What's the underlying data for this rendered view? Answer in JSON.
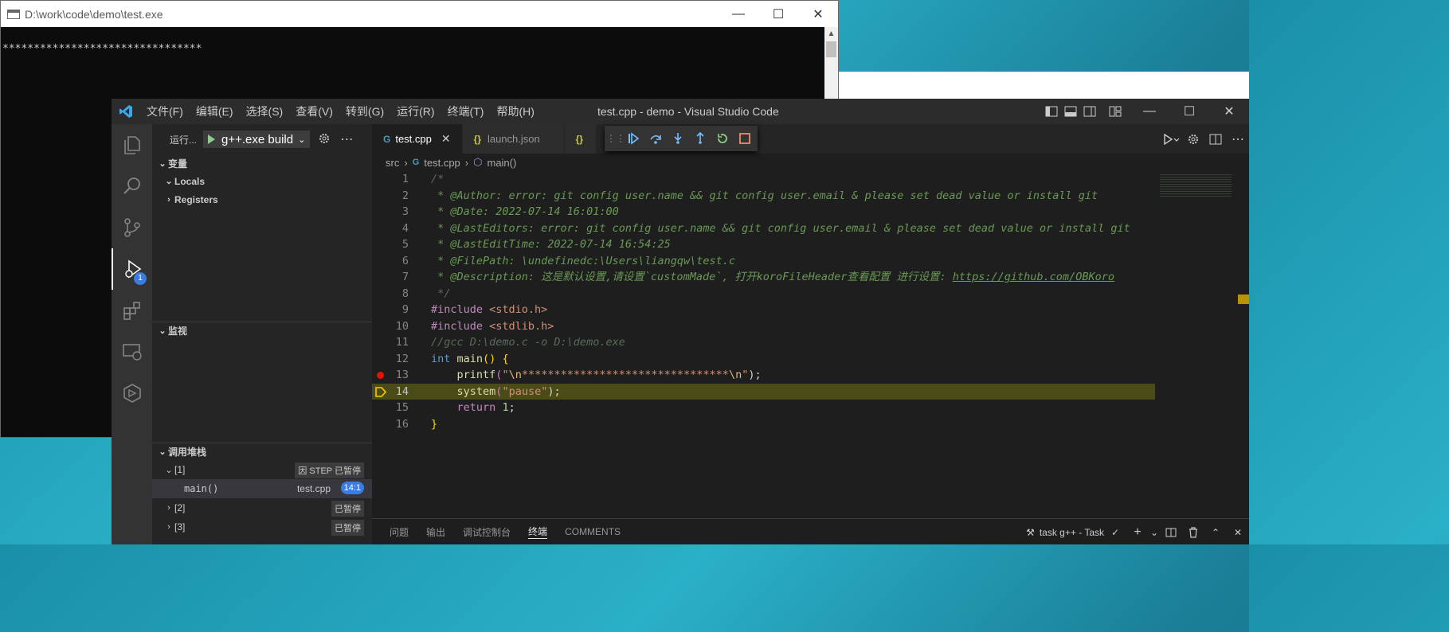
{
  "console": {
    "title": "D:\\work\\code\\demo\\test.exe",
    "output": "********************************"
  },
  "vscode": {
    "title": "test.cpp - demo - Visual Studio Code",
    "menu": [
      "文件(F)",
      "编辑(E)",
      "选择(S)",
      "查看(V)",
      "转到(G)",
      "运行(R)",
      "终端(T)",
      "帮助(H)"
    ],
    "activity_badge": "1",
    "sidebar": {
      "run_label": "运行...",
      "config_name": "g++.exe build",
      "variables_title": "变量",
      "variables": [
        "Locals",
        "Registers"
      ],
      "watch_title": "监视",
      "callstack_title": "调用堆栈",
      "stack": [
        {
          "name": "[1]",
          "status": "因 STEP 已暂停"
        },
        {
          "name": "main()",
          "file": "test.cpp",
          "pos": "14:1"
        },
        {
          "name": "[2]",
          "status": "已暂停"
        },
        {
          "name": "[3]",
          "status": "已暂停"
        }
      ]
    },
    "tabs": [
      {
        "label": "test.cpp",
        "icon": "G",
        "active": true
      },
      {
        "label": "launch.json",
        "icon": "{}"
      },
      {
        "label": "",
        "icon": "{}"
      }
    ],
    "breadcrumbs": [
      "src",
      "test.cpp",
      "main()"
    ],
    "code_lines": [
      {
        "n": "1",
        "t": "/*"
      },
      {
        "n": "2",
        "t": " * @Author: error: git config user.name && git config user.email & please set dead value or install git"
      },
      {
        "n": "3",
        "t": " * @Date: 2022-07-14 16:01:00"
      },
      {
        "n": "4",
        "t": " * @LastEditors: error: git config user.name && git config user.email & please set dead value or install git"
      },
      {
        "n": "5",
        "t": " * @LastEditTime: 2022-07-14 16:54:25"
      },
      {
        "n": "6",
        "t": " * @FilePath: \\undefinedc:\\Users\\liangqw\\test.c"
      },
      {
        "n": "7",
        "t": " * @Description: 这是默认设置,请设置`customMade`, 打开koroFileHeader查看配置 进行设置: ",
        "link": "https://github.com/OBKoro"
      },
      {
        "n": "8",
        "t": " */"
      },
      {
        "n": "9",
        "pp": "#include",
        "rest": " <stdio.h>"
      },
      {
        "n": "10",
        "pp": "#include",
        "rest": " <stdlib.h>"
      },
      {
        "n": "11",
        "t": "//gcc D:\\demo.c -o D:\\demo.exe"
      },
      {
        "n": "12",
        "kw": "int",
        "fn": "main",
        "p": "()",
        "b": "{"
      },
      {
        "n": "13",
        "fn": "printf",
        "str1": "\"",
        "esc1": "\\n",
        "stars": "********************************",
        "esc2": "\\n",
        "str2": "\"",
        "end": ");"
      },
      {
        "n": "14",
        "fn": "system",
        "arg": "\"pause\"",
        "end": ");"
      },
      {
        "n": "15",
        "kw": "return",
        "num": "1",
        "end": ";"
      },
      {
        "n": "16",
        "b": "}"
      }
    ],
    "panel_tabs": [
      "问题",
      "输出",
      "调试控制台",
      "终端",
      "COMMENTS"
    ],
    "panel_task": "task g++ - Task"
  }
}
